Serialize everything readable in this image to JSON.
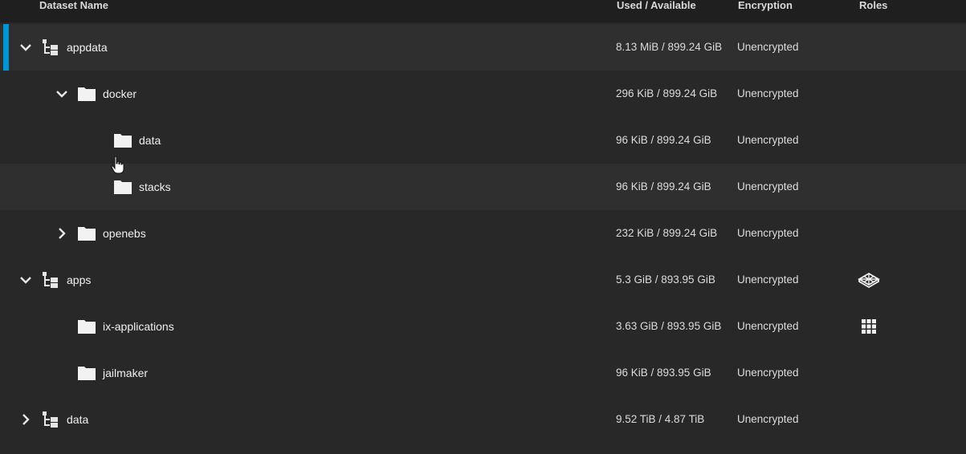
{
  "header": {
    "dataset_name": "Dataset Name",
    "used_available": "Used / Available",
    "encryption": "Encryption",
    "roles": "Roles"
  },
  "rows": [
    {
      "name": "appdata",
      "used": "8.13 MiB / 899.24 GiB",
      "encryption": "Unencrypted"
    },
    {
      "name": "docker",
      "used": "296 KiB / 899.24 GiB",
      "encryption": "Unencrypted"
    },
    {
      "name": "data",
      "used": "96 KiB / 899.24 GiB",
      "encryption": "Unencrypted"
    },
    {
      "name": "stacks",
      "used": "96 KiB / 899.24 GiB",
      "encryption": "Unencrypted"
    },
    {
      "name": "openebs",
      "used": "232 KiB / 899.24 GiB",
      "encryption": "Unencrypted"
    },
    {
      "name": "apps",
      "used": "5.3 GiB / 893.95 GiB",
      "encryption": "Unencrypted",
      "role_icon": "apps-pool-icon"
    },
    {
      "name": "ix-applications",
      "used": "3.63 GiB / 893.95 GiB",
      "encryption": "Unencrypted",
      "role_icon": "applications-grid-icon"
    },
    {
      "name": "jailmaker",
      "used": "96 KiB / 893.95 GiB",
      "encryption": "Unencrypted"
    },
    {
      "name": "data",
      "used": "9.52 TiB / 4.87 TiB",
      "encryption": "Unencrypted"
    }
  ],
  "colors": {
    "background": "#282828",
    "header_bg": "#1f1f1f",
    "selected_accent": "#0095d5"
  }
}
